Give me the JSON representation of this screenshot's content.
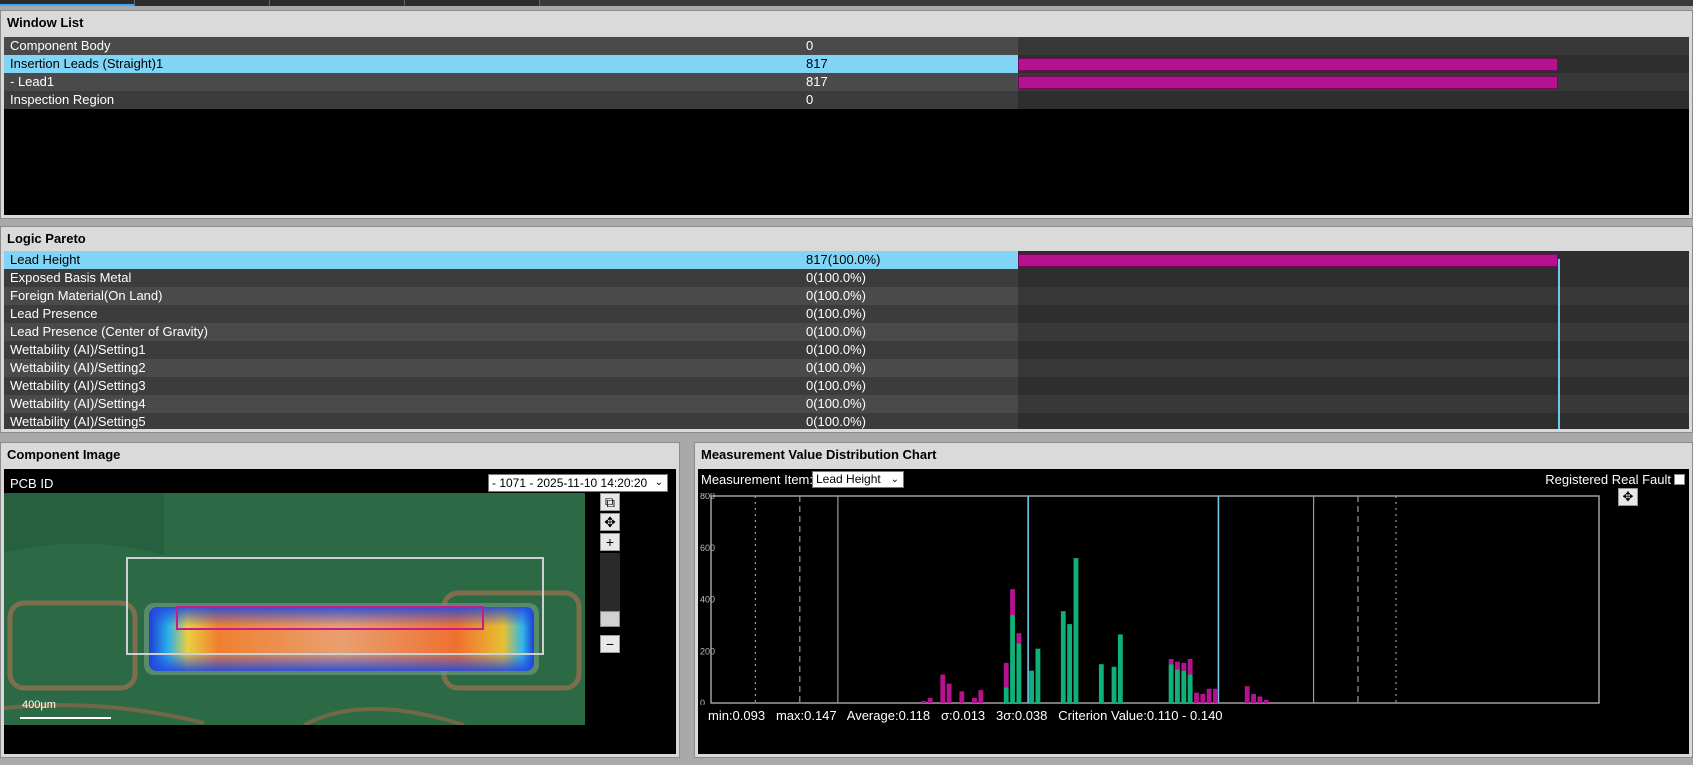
{
  "window_list": {
    "title": "Window List",
    "rows": [
      {
        "name": "Component Body",
        "value": "0",
        "bar_fraction": 0,
        "selected": false
      },
      {
        "name": "Insertion Leads (Straight)1",
        "value": "817",
        "bar_fraction": 1.0,
        "selected": true
      },
      {
        "name": "- Lead1",
        "value": "817",
        "bar_fraction": 1.0,
        "selected": false
      },
      {
        "name": "Inspection Region",
        "value": "0",
        "bar_fraction": 0,
        "selected": false
      }
    ]
  },
  "logic_pareto": {
    "title": "Logic Pareto",
    "rows": [
      {
        "name": "Lead Height",
        "value": "817(100.0%)",
        "bar_fraction": 1.0,
        "selected": true
      },
      {
        "name": "Exposed Basis Metal",
        "value": "0(100.0%)",
        "bar_fraction": 0,
        "selected": false
      },
      {
        "name": "Foreign Material(On Land)",
        "value": "0(100.0%)",
        "bar_fraction": 0,
        "selected": false
      },
      {
        "name": "Lead Presence",
        "value": "0(100.0%)",
        "bar_fraction": 0,
        "selected": false
      },
      {
        "name": "Lead Presence (Center of Gravity)",
        "value": "0(100.0%)",
        "bar_fraction": 0,
        "selected": false
      },
      {
        "name": "Wettability (AI)/Setting1",
        "value": "0(100.0%)",
        "bar_fraction": 0,
        "selected": false
      },
      {
        "name": "Wettability (AI)/Setting2",
        "value": "0(100.0%)",
        "bar_fraction": 0,
        "selected": false
      },
      {
        "name": "Wettability (AI)/Setting3",
        "value": "0(100.0%)",
        "bar_fraction": 0,
        "selected": false
      },
      {
        "name": "Wettability (AI)/Setting4",
        "value": "0(100.0%)",
        "bar_fraction": 0,
        "selected": false
      },
      {
        "name": "Wettability (AI)/Setting5",
        "value": "0(100.0%)",
        "bar_fraction": 0,
        "selected": false
      }
    ]
  },
  "component_image": {
    "title": "Component Image",
    "pcb_label": "PCB ID",
    "pcb_select": "- 1071 - 2025-11-10 14:20:20",
    "scale_label": "400µm",
    "tools": {
      "copy": "⧉",
      "move": "✥",
      "zoom_in": "+",
      "zoom_out": "−"
    }
  },
  "distribution_chart": {
    "title": "Measurement Value Distribution Chart",
    "measurement_item_label": "Measurement Item:",
    "measurement_item_value": "Lead Height",
    "registered_real_fault_label": "Registered Real Fault",
    "registered_real_fault_checked": false,
    "stats": {
      "min": "min:0.093",
      "max": "max:0.147",
      "average": "Average:0.118",
      "sigma": "σ:0.013",
      "three_sigma": "3σ:0.038",
      "criterion": "Criterion Value:0.110 - 0.140"
    },
    "colors": {
      "good": "#10b07a",
      "fault": "#b5128f",
      "criterion": "#6fc8ec"
    }
  },
  "chart_data": {
    "type": "bar",
    "xlim": [
      0.06,
      0.21
    ],
    "ylim": [
      0,
      800
    ],
    "x_ticks": [
      "0.060",
      "0.070",
      "0.080",
      "0.090",
      "0.100",
      "0.110",
      "0.120",
      "0.130",
      "0.140",
      "0.150",
      "0.160",
      "0.170",
      "0.180",
      "0.190",
      "0.200",
      "0.210"
    ],
    "y_ticks": [
      "0",
      "200",
      "400",
      "600",
      "800"
    ],
    "bin_width": 0.001,
    "series": [
      {
        "name": "Good",
        "x": [
          0.106,
          0.107,
          0.108,
          0.11,
          0.111,
          0.113,
          0.115,
          0.116,
          0.117,
          0.121,
          0.123,
          0.124,
          0.126,
          0.127,
          0.131,
          0.132,
          0.133,
          0.134,
          0.135
        ],
        "values": [
          60,
          340,
          230,
          125,
          210,
          0,
          355,
          305,
          560,
          150,
          140,
          265,
          0,
          0,
          0,
          0,
          0,
          0,
          0
        ]
      },
      {
        "name": "Fault",
        "x": [
          0.093,
          0.094,
          0.096,
          0.097,
          0.099,
          0.101,
          0.102,
          0.103,
          0.104,
          0.105,
          0.106,
          0.107,
          0.108,
          0.109,
          0.11,
          0.111,
          0.112,
          0.136,
          0.137,
          0.138,
          0.139,
          0.14,
          0.141,
          0.142,
          0.143,
          0.144,
          0.145,
          0.146,
          0.147
        ],
        "values": [
          8,
          20,
          110,
          75,
          45,
          20,
          50,
          0,
          0,
          0,
          95,
          100,
          40,
          0,
          0,
          0,
          0,
          40,
          35,
          55,
          55,
          0,
          0,
          0,
          0,
          65,
          35,
          25,
          12
        ]
      },
      {
        "name": "Good2",
        "x": [
          0.132,
          0.133,
          0.134,
          0.135,
          0.136,
          0.137,
          0.138,
          0.139
        ],
        "values": [
          150,
          130,
          125,
          110,
          0,
          0,
          0,
          0
        ]
      },
      {
        "name": "Fault2",
        "x": [
          0.132,
          0.133,
          0.134,
          0.135
        ],
        "values": [
          20,
          30,
          30,
          60
        ]
      }
    ],
    "vlines": [
      {
        "x": 0.067,
        "style": "dotted"
      },
      {
        "x": 0.074,
        "style": "dashed"
      },
      {
        "x": 0.08,
        "style": "solid"
      },
      {
        "x": 0.11,
        "style": "criterion"
      },
      {
        "x": 0.14,
        "style": "criterion"
      },
      {
        "x": 0.155,
        "style": "solid"
      },
      {
        "x": 0.162,
        "style": "dashed"
      },
      {
        "x": 0.168,
        "style": "dotted"
      }
    ]
  }
}
